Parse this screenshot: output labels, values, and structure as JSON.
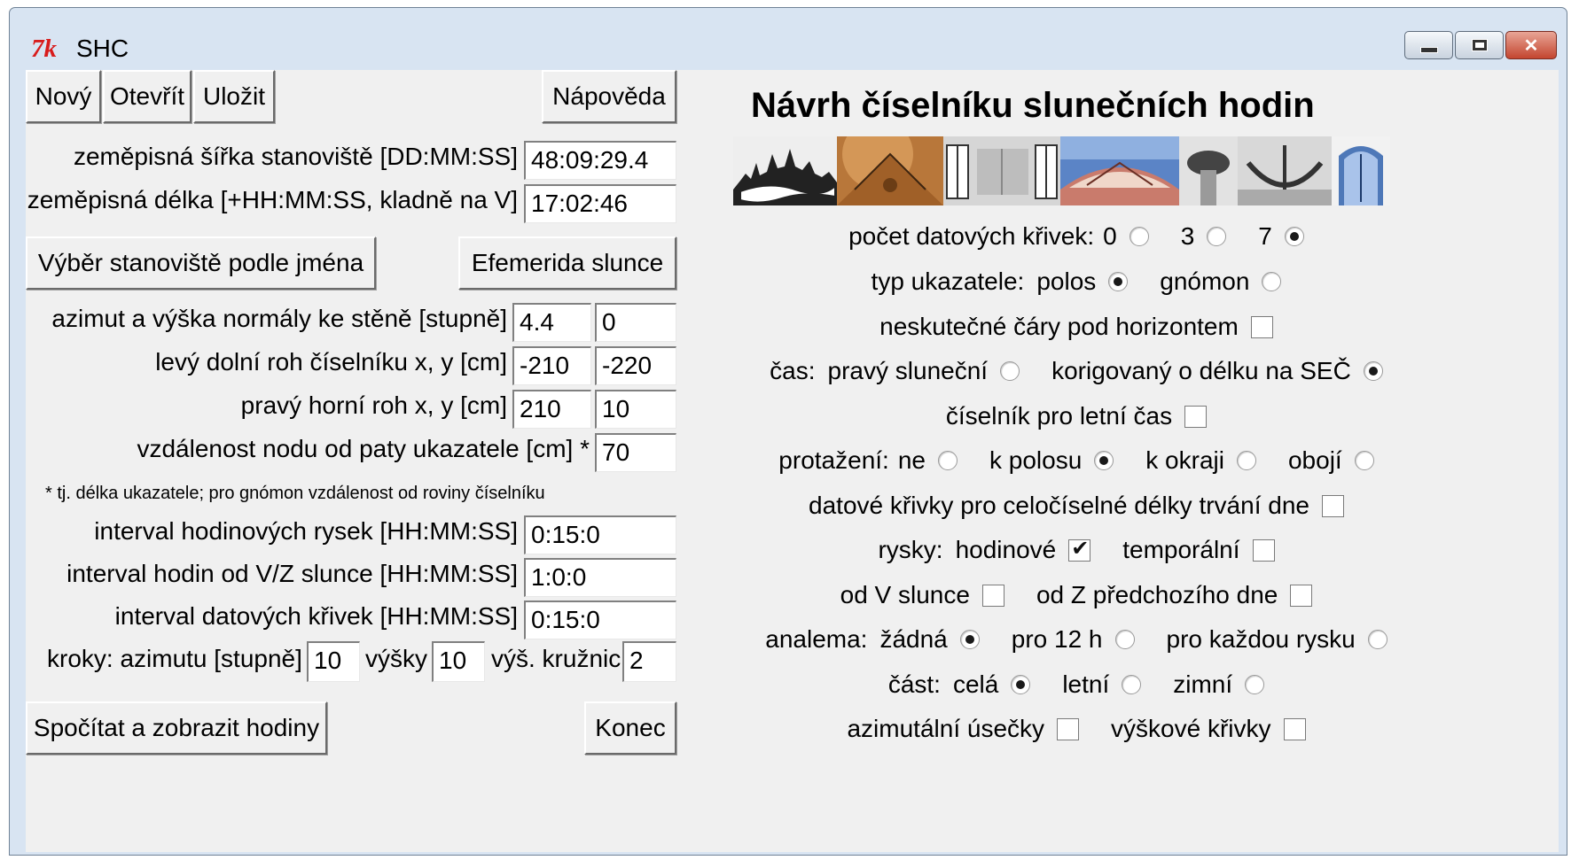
{
  "window": {
    "title": "SHC",
    "logo_text": "7k"
  },
  "toolbar": {
    "new": "Nový",
    "open": "Otevřít",
    "save": "Uložit",
    "help": "Nápověda"
  },
  "location": {
    "lat_label": "zeměpisná šířka stanoviště [DD:MM:SS]",
    "lat_value": "48:09:29.4",
    "lon_label": "zeměpisná délka [+HH:MM:SS, kladně na V]",
    "lon_value": "17:02:46",
    "select_by_name": "Výběr stanoviště podle jména",
    "ephemeris": "Efemerida slunce"
  },
  "geometry": {
    "normal_label": "azimut a výška normály ke stěně [stupně]",
    "normal_az": "4.4",
    "normal_alt": "0",
    "ll_label": "levý dolní roh číselníku x, y [cm]",
    "ll_x": "-210",
    "ll_y": "-220",
    "ur_label": "pravý horní roh x, y [cm]",
    "ur_x": "210",
    "ur_y": "10",
    "node_label": "vzdálenost nodu od paty ukazatele [cm] *",
    "node_value": "70",
    "note": "* tj. délka ukazatele; pro gnómon vzdálenost od roviny číselníku"
  },
  "intervals": {
    "hour_lines_label": "interval hodinových rysek [HH:MM:SS]",
    "hour_lines_value": "0:15:0",
    "sunrise_label": "interval hodin od V/Z slunce [HH:MM:SS]",
    "sunrise_value": "1:0:0",
    "date_curves_label": "interval datových křivek [HH:MM:SS]",
    "date_curves_value": "0:15:0"
  },
  "steps": {
    "prefix": "kroky: azimutu [stupně]",
    "azimuth": "10",
    "altitude_label": "výšky",
    "altitude": "10",
    "circles_label": "výš. kružnic",
    "circles": "2"
  },
  "actions": {
    "compute": "Spočítat a zobrazit hodiny",
    "quit": "Konec"
  },
  "right": {
    "heading": "Návrh číselníku slunečních hodin",
    "date_curves": {
      "label": "počet datových křivek:",
      "o0": "0",
      "o3": "3",
      "o7": "7",
      "selected": "7"
    },
    "pointer": {
      "label": "typ ukazatele:",
      "polos": "polos",
      "gnomon": "gnómon",
      "selected": "polos"
    },
    "unreal_lines": {
      "label": "neskutečné čáry pod horizontem",
      "checked": false
    },
    "time": {
      "label": "čas:",
      "true_solar": "pravý sluneční",
      "corrected": "korigovaný o délku na SEČ",
      "selected": "corrected"
    },
    "summer_dial": {
      "label": "číselník pro letní čas",
      "checked": false
    },
    "extension": {
      "label": "protažení:",
      "no": "ne",
      "to_polos": "k polosu",
      "to_edge": "k okraji",
      "both": "obojí",
      "selected": "to_polos"
    },
    "integer_day_curves": {
      "label": "datové křivky pro celočíselné délky trvání dne",
      "checked": false
    },
    "lines": {
      "label": "rysky:",
      "hourly": "hodinové",
      "hourly_checked": true,
      "temporal": "temporální",
      "temporal_checked": false
    },
    "from_sun": {
      "sunrise": "od V slunce",
      "sunrise_checked": false,
      "sunset": "od Z předchozího dne",
      "sunset_checked": false
    },
    "analemma": {
      "label": "analema:",
      "none": "žádná",
      "noon": "pro 12 h",
      "each": "pro každou rysku",
      "selected": "none"
    },
    "part": {
      "label": "část:",
      "whole": "celá",
      "summer": "letní",
      "winter": "zimní",
      "selected": "whole"
    },
    "extra": {
      "azimuth_segments": "azimutální úsečky",
      "azimuth_checked": false,
      "altitude_curves": "výškové křivky",
      "altitude_checked": false
    }
  },
  "colors": {
    "frame": "#d8e4f2",
    "client": "#f0f0f0",
    "logo": "#d81c1c"
  }
}
